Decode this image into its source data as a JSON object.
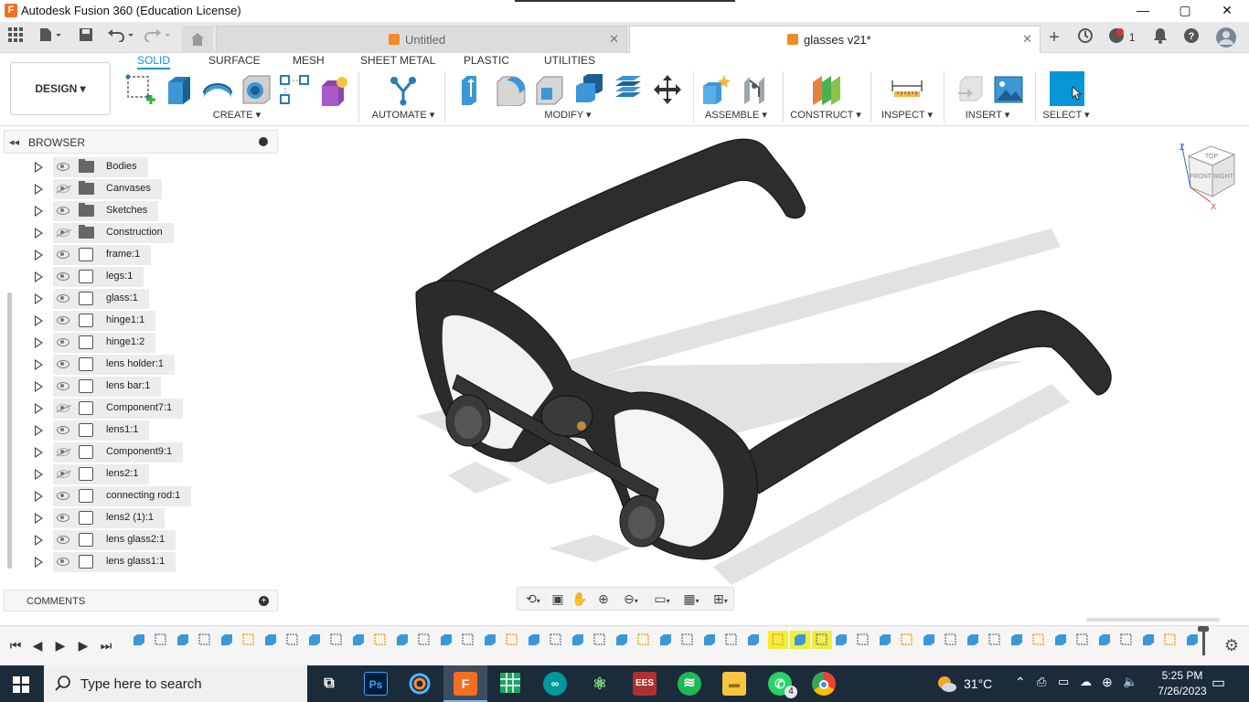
{
  "window": {
    "title": "Autodesk Fusion 360 (Education License)",
    "app_icon_letter": "F",
    "minimize": "—",
    "maximize": "▢",
    "close": "✕"
  },
  "tabs": [
    {
      "label": "Untitled",
      "active": false
    },
    {
      "label": "glasses v21*",
      "active": true
    }
  ],
  "header_right": {
    "notifications_count": "1"
  },
  "design_button": "DESIGN ▾",
  "toolbar_tabs": [
    "SOLID",
    "SURFACE",
    "MESH",
    "SHEET METAL",
    "PLASTIC",
    "UTILITIES"
  ],
  "tool_groups": {
    "create": "CREATE ▾",
    "automate": "AUTOMATE ▾",
    "modify": "MODIFY ▾",
    "assemble": "ASSEMBLE ▾",
    "construct": "CONSTRUCT ▾",
    "inspect": "INSPECT ▾",
    "insert": "INSERT ▾",
    "select": "SELECT ▾"
  },
  "browser": {
    "header": "BROWSER",
    "items": [
      {
        "label": "Bodies",
        "type": "folder",
        "visible": true
      },
      {
        "label": "Canvases",
        "type": "folder",
        "visible": false
      },
      {
        "label": "Sketches",
        "type": "folder",
        "visible": true
      },
      {
        "label": "Construction",
        "type": "folder",
        "visible": false
      },
      {
        "label": "frame:1",
        "type": "component",
        "visible": true
      },
      {
        "label": "legs:1",
        "type": "component",
        "visible": true
      },
      {
        "label": "glass:1",
        "type": "component",
        "visible": true
      },
      {
        "label": "hinge1:1",
        "type": "component",
        "visible": true
      },
      {
        "label": "hinge1:2",
        "type": "component",
        "visible": true
      },
      {
        "label": "lens holder:1",
        "type": "component",
        "visible": true
      },
      {
        "label": "lens bar:1",
        "type": "component",
        "visible": true
      },
      {
        "label": "Component7:1",
        "type": "component",
        "visible": false
      },
      {
        "label": "lens1:1",
        "type": "component",
        "visible": true
      },
      {
        "label": "Component9:1",
        "type": "component",
        "visible": false
      },
      {
        "label": "lens2:1",
        "type": "component",
        "visible": false
      },
      {
        "label": "connecting rod:1",
        "type": "component",
        "visible": true
      },
      {
        "label": "lens2 (1):1",
        "type": "component",
        "visible": true
      },
      {
        "label": "lens glass2:1",
        "type": "component",
        "visible": true
      },
      {
        "label": "lens glass1:1",
        "type": "component",
        "visible": true
      }
    ]
  },
  "comments": {
    "header": "COMMENTS"
  },
  "viewcube": {
    "top": "TOP",
    "front": "FRONT",
    "right": "RIGHT",
    "axis_z": "Z",
    "axis_x": "X"
  },
  "taskbar": {
    "search_placeholder": "Type here to search",
    "temperature": "31°C",
    "time": "5:25 PM",
    "date": "7/26/2023",
    "whatsapp_badge": "4"
  },
  "colors": {
    "accent": "#0696d7",
    "taskbar": "#1c2b3a",
    "fusion_orange": "#f26f22",
    "frame": "#2a2a2a"
  }
}
